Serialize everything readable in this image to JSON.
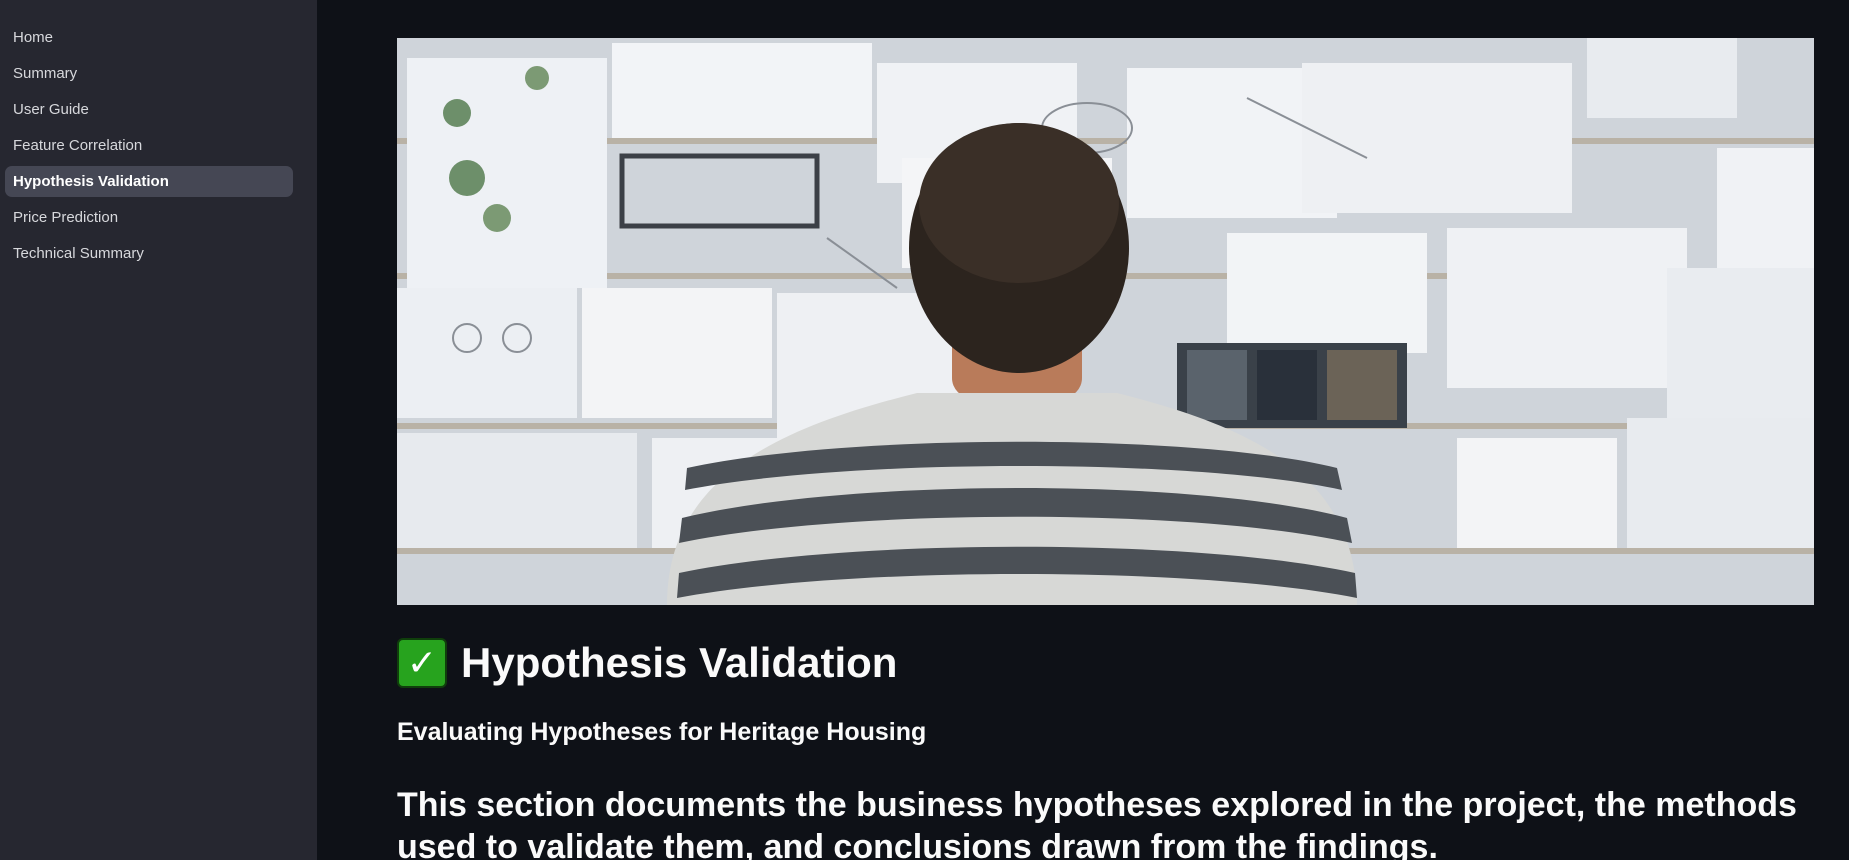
{
  "sidebar": {
    "items": [
      {
        "label": "Home"
      },
      {
        "label": "Summary"
      },
      {
        "label": "User Guide"
      },
      {
        "label": "Feature Correlation"
      },
      {
        "label": "Hypothesis Validation",
        "active": true
      },
      {
        "label": "Price Prediction"
      },
      {
        "label": "Technical Summary"
      }
    ]
  },
  "main": {
    "hero_image": {
      "description": "person-facing-wall-of-pinned-papers"
    },
    "title_icon": "check-mark-icon",
    "title": "Hypothesis Validation",
    "subtitle": "Evaluating Hypotheses for Heritage Housing",
    "intro": "This section documents the business hypotheses explored in the project, the methods used to validate them, and conclusions drawn from the findings."
  },
  "colors": {
    "background": "#0e1117",
    "sidebar": "#262730",
    "active_item": "#454754",
    "check_green": "#27a31e"
  }
}
